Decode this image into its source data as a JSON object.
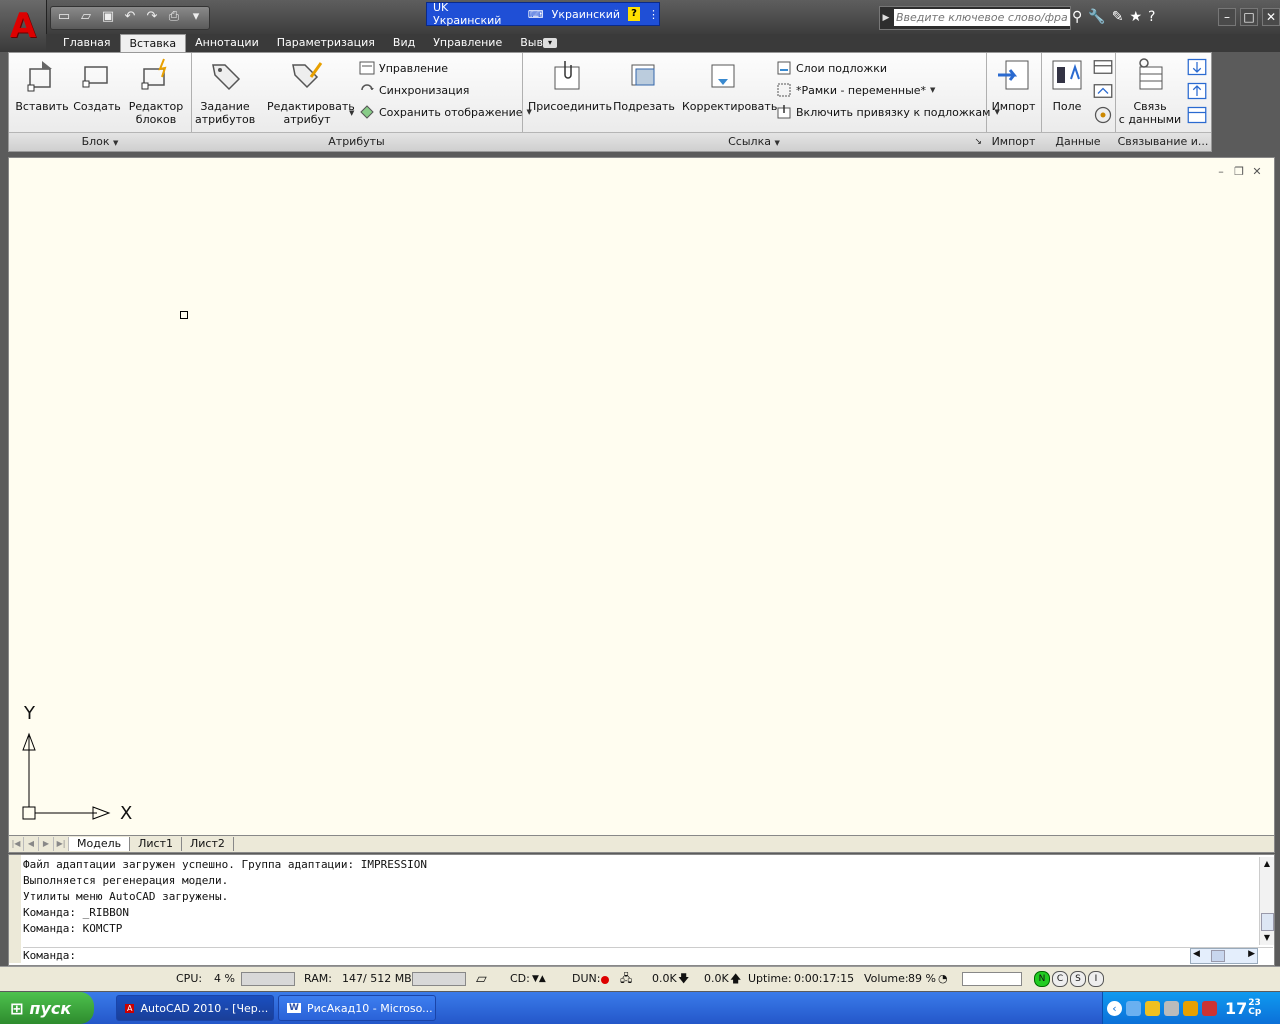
{
  "titlebar": {
    "language_bar": {
      "lang_code": "UK Украинский",
      "keyboard": "Украинский",
      "help": "?"
    },
    "search": {
      "placeholder": "Введите ключевое слово/фразу"
    }
  },
  "tabs": [
    {
      "label": "Главная"
    },
    {
      "label": "Вставка",
      "active": true
    },
    {
      "label": "Аннотации"
    },
    {
      "label": "Параметризация"
    },
    {
      "label": "Вид"
    },
    {
      "label": "Управление"
    },
    {
      "label": "Вывод"
    }
  ],
  "ribbon": {
    "block": {
      "title": "Блок",
      "insert": "Вставить",
      "create": "Создать",
      "editor_1": "Редактор",
      "editor_2": "блоков"
    },
    "attributes": {
      "title": "Атрибуты",
      "define_1": "Задание",
      "define_2": "атрибутов",
      "edit_1": "Редактировать",
      "edit_2": "атрибут",
      "manage": "Управление",
      "sync": "Синхронизация",
      "retain": "Сохранить отображение"
    },
    "reference": {
      "title": "Ссылка",
      "attach": "Присоединить",
      "clip": "Подрезать",
      "adjust": "Корректировать",
      "underlay_layers": "Слои подложки",
      "frames": "*Рамки - переменные*",
      "snap": "Включить привязку к подложкам"
    },
    "import": {
      "title": "Импорт",
      "import": "Импорт"
    },
    "data": {
      "title": "Данные",
      "field": "Поле"
    },
    "linking": {
      "title": "Связывание и...",
      "link_1": "Связь",
      "link_2": "с данными"
    }
  },
  "drawing": {
    "ucs_x": "X",
    "ucs_y": "Y"
  },
  "layout_tabs": [
    {
      "label": "Модель",
      "active": true
    },
    {
      "label": "Лист1"
    },
    {
      "label": "Лист2"
    }
  ],
  "command": {
    "history": [
      "Файл адаптации загружен успешно. Группа адаптации: IMPRESSION",
      "Выполняется регенерация модели.",
      "Утилиты меню AutoCAD загружены.",
      "Команда: _RIBBON",
      "Команда: КОМСТР"
    ],
    "prompt": "Команда:"
  },
  "monitor": {
    "cpu_label": "CPU:",
    "cpu_value": "4 %",
    "ram_label": "RAM:",
    "ram_value": "147/ 512 MB",
    "cd_label": "CD:",
    "dun_label": "DUN:",
    "down": "0.0K",
    "up": "0.0K",
    "uptime_label": "Uptime:",
    "uptime_value": "0:00:17:15",
    "volume_label": "Volume:",
    "volume_value": "89 %",
    "toggles": [
      "N",
      "C",
      "S",
      "I"
    ]
  },
  "taskbar": {
    "start": "пуск",
    "tasks": [
      {
        "label": "AutoCAD 2010 - [Чер..."
      },
      {
        "label": "РисАкад10 - Microso..."
      }
    ],
    "clock": "17",
    "clock_min": "23",
    "clock_day": "Ср"
  },
  "colors": {
    "drawing_bg": "#fffdf0",
    "language_bar": "#1f4fd6",
    "taskbar": "#2457c9",
    "start": "#2e8b2e"
  }
}
